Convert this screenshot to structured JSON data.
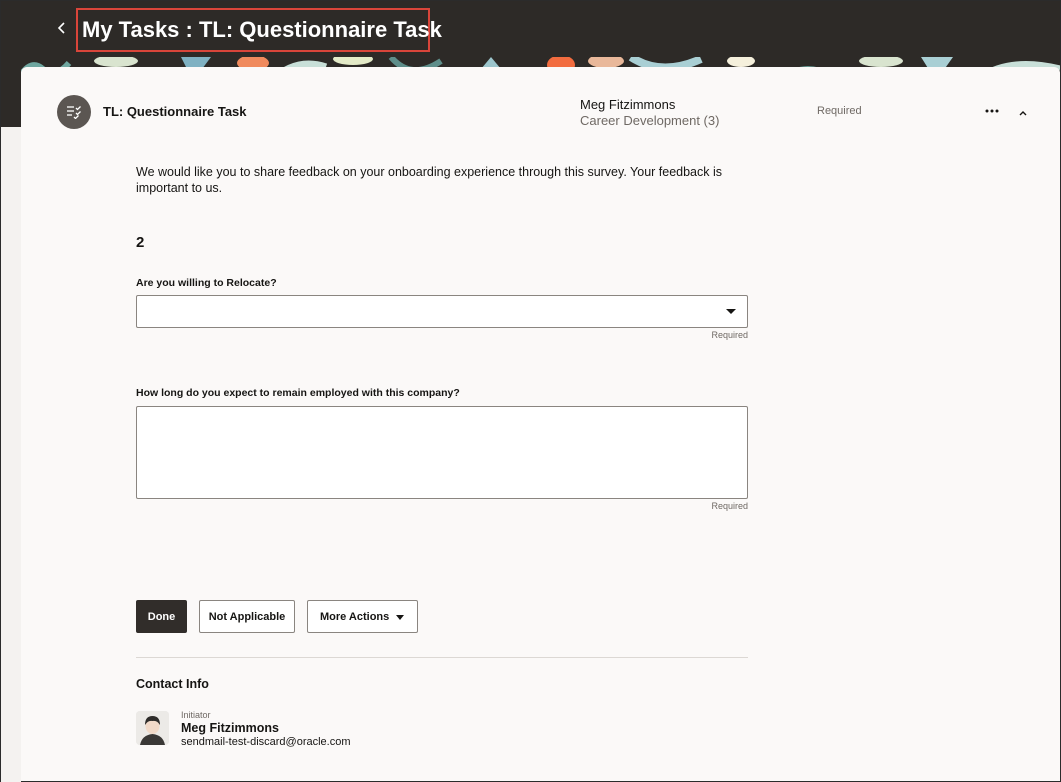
{
  "header": {
    "title": "My Tasks : TL: Questionnaire Task",
    "back_icon": "chevron-left-icon"
  },
  "task": {
    "icon": "checklist-icon",
    "name": "TL: Questionnaire Task",
    "assignee": "Meg Fitzimmons",
    "category": "Career Development (3)",
    "status": "Required",
    "more_icon": "ellipsis-icon",
    "collapse_icon": "chevron-up-icon"
  },
  "form": {
    "intro": "We would like you to share feedback on your onboarding experience through this survey. Your feedback is important to us.",
    "section_number": "2",
    "questions": [
      {
        "label": "Are you willing to Relocate?",
        "value": "",
        "required_note": "Required"
      },
      {
        "label": "How long do you expect to remain employed with this company?",
        "value": "",
        "required_note": "Required"
      }
    ]
  },
  "actions": {
    "done": "Done",
    "not_applicable": "Not Applicable",
    "more_actions": "More Actions"
  },
  "contact": {
    "title": "Contact Info",
    "role": "Initiator",
    "name": "Meg Fitzimmons",
    "email": "sendmail-test-discard@oracle.com"
  },
  "colors": {
    "header_bg": "#2d2a27",
    "highlight_border": "#d9453a",
    "primary_button": "#312d2a",
    "card_bg": "#fbf9f8"
  }
}
